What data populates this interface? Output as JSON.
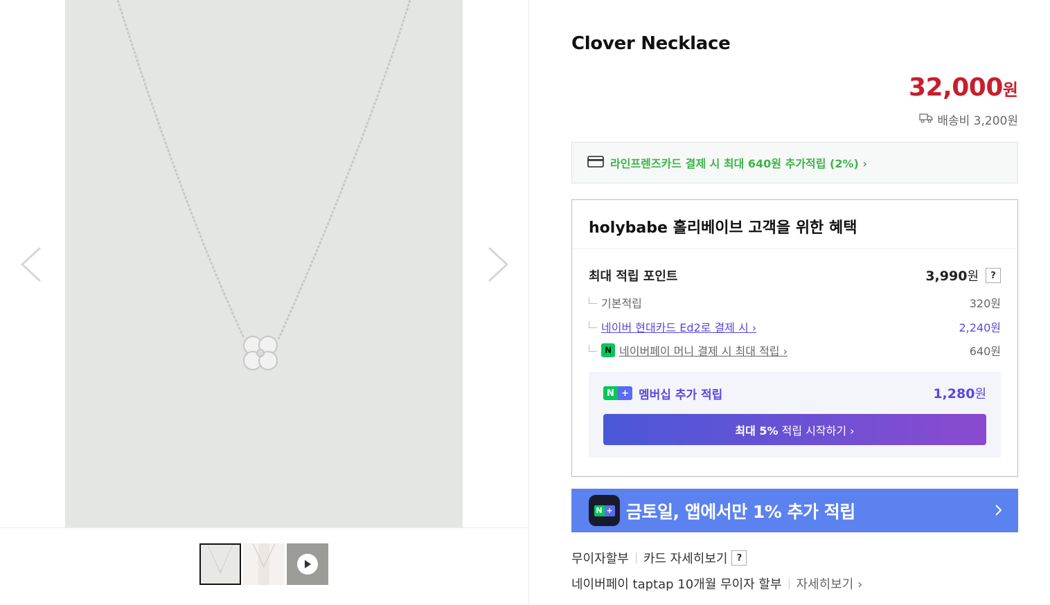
{
  "product": {
    "title": "Clover Necklace",
    "price": "32,000",
    "price_unit": "원",
    "shipping": "배송비 3,200원"
  },
  "gallery": {
    "prev_icon": "chevron-left-icon",
    "next_icon": "chevron-right-icon",
    "thumbnails": [
      "necklace-front",
      "necklace-worn",
      "video"
    ]
  },
  "card_banner": {
    "text": "라인프렌즈카드 결제 시 최대 640원 추가적립 (2%) ›"
  },
  "benefits": {
    "title": "holybabe 홀리베이브 고객을 위한 혜택",
    "max_points_label": "최대 적립 포인트",
    "max_points_value": "3,990",
    "won": "원",
    "help": "?",
    "rows": [
      {
        "label": "기본적립",
        "value": "320원"
      },
      {
        "label": "네이버 현대카드 Ed2로 결제 시 ›",
        "value": "2,240원"
      },
      {
        "label": "네이버페이 머니 결제 시 최대 적립 ›",
        "value": "640원"
      }
    ],
    "membership": {
      "badge_n": "N",
      "badge_plus": "+",
      "label": "멤버십 추가 적립",
      "value": "1,280",
      "unit": "원",
      "button_bold": "최대 5%",
      "button_rest": " 적립 시작하기 ›"
    }
  },
  "app_banner": {
    "text": "금토일, 앱에서만 1% 추가 적립"
  },
  "installments": {
    "row1_label": "무이자할부",
    "row1_link": "카드 자세히보기",
    "row1_help": "?",
    "row2_label": "네이버페이 taptap 10개월 무이자 할부",
    "row2_link": "자세히보기 ›"
  },
  "colors": {
    "price": "#c81e2d",
    "green": "#3cb449",
    "purple": "#5a46e0",
    "app_banner": "#5b82ee"
  }
}
